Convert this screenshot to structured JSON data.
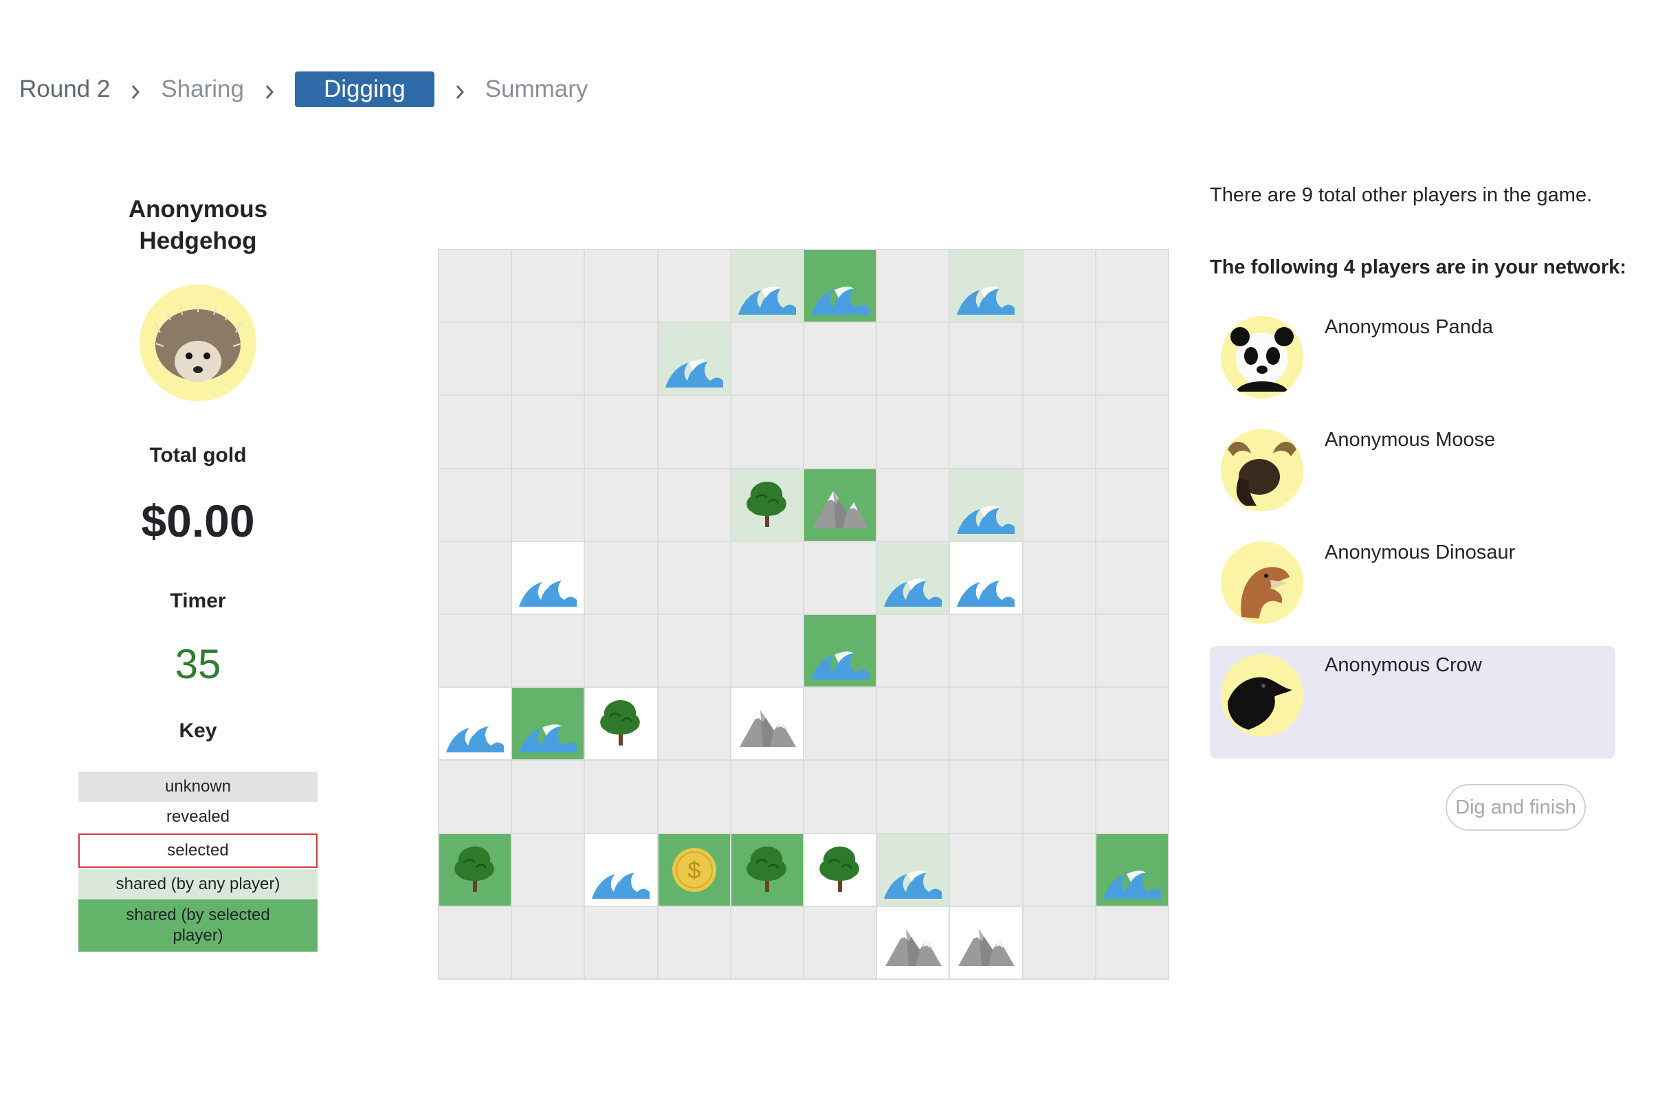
{
  "breadcrumb": {
    "items": [
      "Round 2",
      "Sharing",
      "Digging",
      "Summary"
    ]
  },
  "player": {
    "name": "Anonymous Hedgehog",
    "avatar_icon": "hedgehog-icon",
    "gold_label": "Total gold",
    "gold_value": "$0.00",
    "timer_label": "Timer",
    "timer_value": "35"
  },
  "key": {
    "title": "Key",
    "items": [
      "unknown",
      "revealed",
      "selected",
      "shared (by any player)",
      "shared (by selected player)"
    ]
  },
  "grid": {
    "rows": 10,
    "cols": 10,
    "cells": [
      [
        [
          "u",
          ""
        ],
        [
          "u",
          ""
        ],
        [
          "u",
          ""
        ],
        [
          "u",
          ""
        ],
        [
          "a",
          "water"
        ],
        [
          "s",
          "water"
        ],
        [
          "u",
          ""
        ],
        [
          "a",
          "water"
        ],
        [
          "u",
          ""
        ],
        [
          "u",
          ""
        ]
      ],
      [
        [
          "u",
          ""
        ],
        [
          "u",
          ""
        ],
        [
          "u",
          ""
        ],
        [
          "a",
          "water"
        ],
        [
          "u",
          ""
        ],
        [
          "u",
          ""
        ],
        [
          "u",
          ""
        ],
        [
          "u",
          ""
        ],
        [
          "u",
          ""
        ],
        [
          "u",
          ""
        ]
      ],
      [
        [
          "u",
          ""
        ],
        [
          "u",
          ""
        ],
        [
          "u",
          ""
        ],
        [
          "u",
          ""
        ],
        [
          "u",
          ""
        ],
        [
          "u",
          ""
        ],
        [
          "u",
          ""
        ],
        [
          "u",
          ""
        ],
        [
          "u",
          ""
        ],
        [
          "u",
          ""
        ]
      ],
      [
        [
          "u",
          ""
        ],
        [
          "u",
          ""
        ],
        [
          "u",
          ""
        ],
        [
          "u",
          ""
        ],
        [
          "a",
          "tree"
        ],
        [
          "s",
          "mountain"
        ],
        [
          "u",
          ""
        ],
        [
          "a",
          "water"
        ],
        [
          "u",
          ""
        ],
        [
          "u",
          ""
        ]
      ],
      [
        [
          "u",
          ""
        ],
        [
          "r",
          "water"
        ],
        [
          "u",
          ""
        ],
        [
          "u",
          ""
        ],
        [
          "u",
          ""
        ],
        [
          "u",
          ""
        ],
        [
          "a",
          "water"
        ],
        [
          "r",
          "water"
        ],
        [
          "u",
          ""
        ],
        [
          "u",
          ""
        ]
      ],
      [
        [
          "u",
          ""
        ],
        [
          "u",
          ""
        ],
        [
          "u",
          ""
        ],
        [
          "u",
          ""
        ],
        [
          "u",
          ""
        ],
        [
          "s",
          "water"
        ],
        [
          "u",
          ""
        ],
        [
          "u",
          ""
        ],
        [
          "u",
          ""
        ],
        [
          "u",
          ""
        ]
      ],
      [
        [
          "r",
          "water"
        ],
        [
          "s",
          "water"
        ],
        [
          "r",
          "tree"
        ],
        [
          "u",
          ""
        ],
        [
          "r",
          "mountain"
        ],
        [
          "u",
          ""
        ],
        [
          "u",
          ""
        ],
        [
          "u",
          ""
        ],
        [
          "u",
          ""
        ],
        [
          "u",
          ""
        ]
      ],
      [
        [
          "u",
          ""
        ],
        [
          "u",
          ""
        ],
        [
          "u",
          ""
        ],
        [
          "u",
          ""
        ],
        [
          "u",
          ""
        ],
        [
          "u",
          ""
        ],
        [
          "u",
          ""
        ],
        [
          "u",
          ""
        ],
        [
          "u",
          ""
        ],
        [
          "u",
          ""
        ]
      ],
      [
        [
          "s",
          "tree"
        ],
        [
          "u",
          ""
        ],
        [
          "r",
          "water"
        ],
        [
          "s",
          "gold"
        ],
        [
          "s",
          "tree"
        ],
        [
          "r",
          "tree"
        ],
        [
          "a",
          "water"
        ],
        [
          "u",
          ""
        ],
        [
          "u",
          ""
        ],
        [
          "s",
          "water"
        ]
      ],
      [
        [
          "u",
          ""
        ],
        [
          "u",
          ""
        ],
        [
          "u",
          ""
        ],
        [
          "u",
          ""
        ],
        [
          "u",
          ""
        ],
        [
          "u",
          ""
        ],
        [
          "r",
          "mountain"
        ],
        [
          "r",
          "mountain"
        ],
        [
          "u",
          ""
        ],
        [
          "u",
          ""
        ]
      ]
    ]
  },
  "game": {
    "players_total_text": "There are 9 total other players in the game.",
    "network_title": "The following 4 players are in your network:",
    "network_players": [
      {
        "name": "Anonymous Panda",
        "icon": "panda-icon"
      },
      {
        "name": "Anonymous Moose",
        "icon": "moose-icon"
      },
      {
        "name": "Anonymous Dinosaur",
        "icon": "dinosaur-icon"
      },
      {
        "name": "Anonymous Crow",
        "icon": "crow-icon"
      }
    ],
    "selected_player_index": 3,
    "dig_button_label": "Dig and finish"
  },
  "colors": {
    "accent": "#2f6aa8",
    "unknown": "#ebebeb",
    "shared_any": "#d9e8d9",
    "shared_selected": "#64b36a",
    "selected_border": "#d33b3b",
    "timer": "#2e7d32",
    "highlight": "#e8e8f5"
  }
}
